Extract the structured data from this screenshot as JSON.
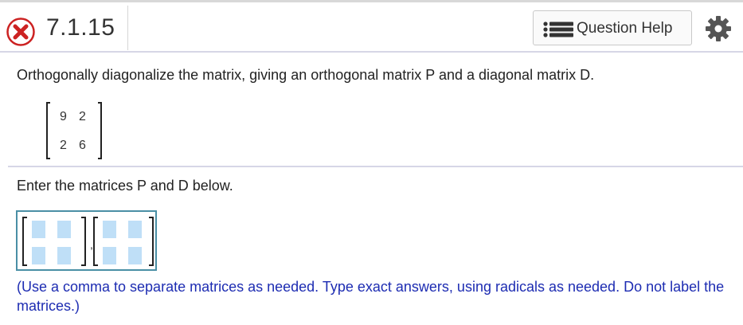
{
  "header": {
    "question_number": "7.1.15",
    "status_icon": "incorrect-x-icon",
    "help_button_label": "Question Help",
    "help_icon": "list-icon",
    "settings_icon": "gear-icon"
  },
  "question": {
    "instruction": "Orthogonally diagonalize the matrix, giving an orthogonal matrix P and a diagonal matrix D.",
    "matrix": {
      "row1": [
        "9",
        "2"
      ],
      "row2": [
        "2",
        "6"
      ]
    }
  },
  "answer": {
    "prompt": "Enter the matrices P and D below.",
    "separator": ",",
    "note": "(Use a comma to separate matrices as needed. Type exact answers, using radicals as needed. Do not label the matrices.)"
  },
  "colors": {
    "incorrect": "#cc2222",
    "note_text": "#1d2cb2",
    "answer_border": "#4a8fa5",
    "slot_fill": "#bfdff7"
  }
}
